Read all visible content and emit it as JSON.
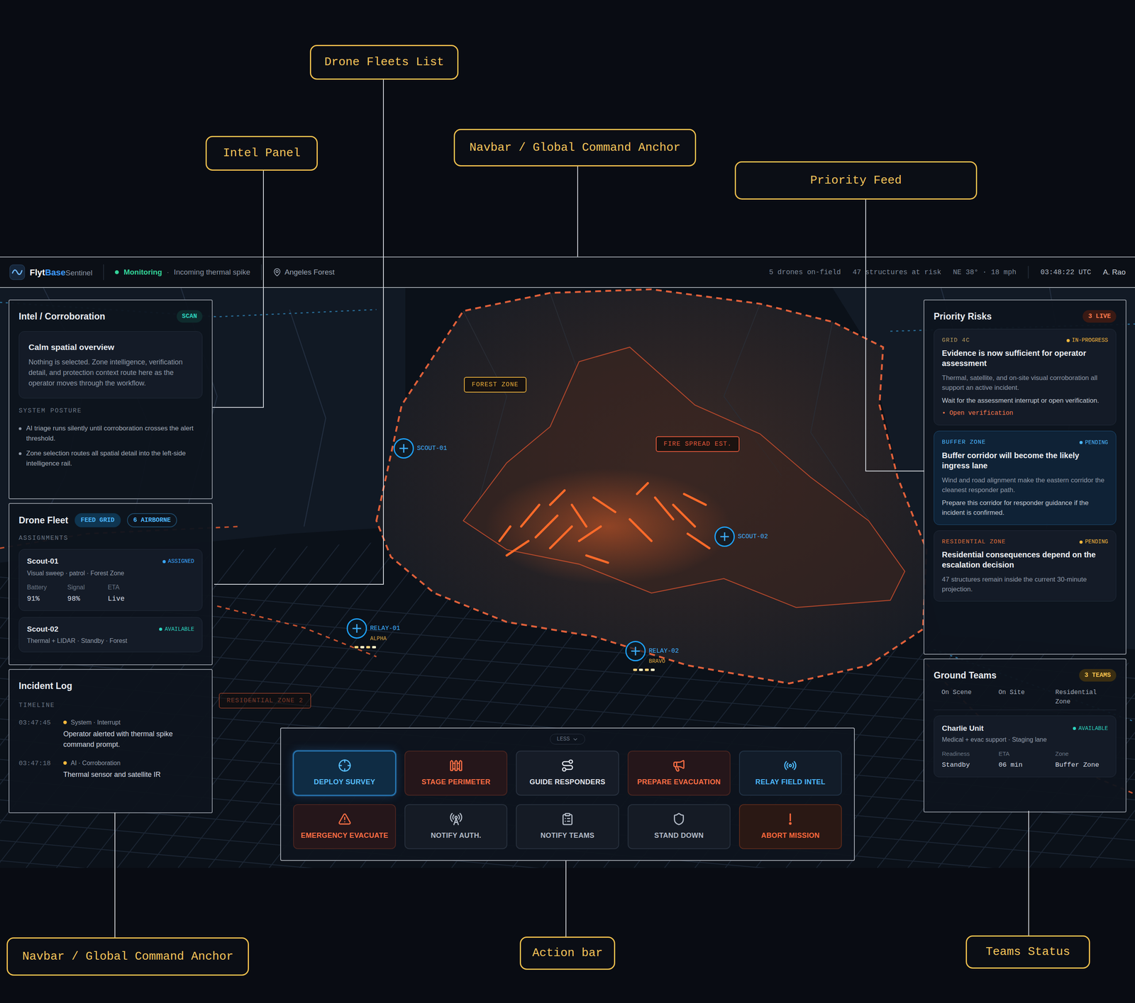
{
  "callouts": [
    {
      "text": "Drone Fleets List"
    },
    {
      "text": "Intel Panel"
    },
    {
      "text": "Navbar / Global Command Anchor"
    },
    {
      "text": "Priority Feed"
    },
    {
      "text": "Navbar / Global Command Anchor"
    },
    {
      "text": "Action bar"
    },
    {
      "text": "Teams Status"
    }
  ],
  "navbar": {
    "brand": {
      "part1": "Flyt",
      "part2": "Base",
      "product": "Sentinel"
    },
    "status": {
      "label": "Monitoring",
      "color": "#34d399"
    },
    "separator": "·",
    "event": "Incoming thermal spike",
    "location": "Angeles Forest",
    "stats": [
      "5 drones on-field",
      "47 structures at risk",
      "NE 38° · 18 mph"
    ],
    "clock": "03:48:22 UTC",
    "user": "A. Rao"
  },
  "intel": {
    "title": "Intel / Corroboration",
    "badge": "SCAN",
    "card": {
      "title": "Calm spatial overview",
      "body": "Nothing is selected. Zone intelligence, verification detail, and protection context route here as the operator moves through the workflow."
    },
    "section": "SYSTEM POSTURE",
    "bullets": [
      "AI triage runs silently until corroboration crosses the alert threshold.",
      "Zone selection routes all spatial detail into the left-side intelligence rail."
    ]
  },
  "fleet": {
    "title": "Drone Fleet",
    "tabs": [
      {
        "label": "FEED GRID",
        "selected": true
      },
      {
        "label": "6 AIRBORNE",
        "selected": false
      }
    ],
    "section": "ASSIGNMENTS",
    "drones": [
      {
        "name": "Scout-01",
        "detail": "Visual sweep · patrol · Forest Zone",
        "status": "ASSIGNED",
        "color": "#3aa7ff",
        "stats": [
          {
            "label": "Battery",
            "value": "91%"
          },
          {
            "label": "Signal",
            "value": "98%"
          },
          {
            "label": "ETA",
            "value": "Live"
          }
        ]
      },
      {
        "name": "Scout-02",
        "detail": "Thermal + LIDAR · Standby · Forest",
        "status": "AVAILABLE",
        "color": "#2dd4bf",
        "stats": []
      }
    ]
  },
  "incident": {
    "title": "Incident Log",
    "section": "TIMELINE",
    "entries": [
      {
        "time": "03:47:45",
        "source": "System · Interrupt",
        "text": "Operator alerted with thermal spike command prompt.",
        "color": "#f5b83d"
      },
      {
        "time": "03:47:18",
        "source": "AI · Corroboration",
        "text": "Thermal sensor and satellite IR",
        "color": "#f5b83d"
      }
    ]
  },
  "risks": {
    "title": "Priority Risks",
    "badge": "3 LIVE",
    "items": [
      {
        "zone": "GRID 4C",
        "color": "#b79a5e",
        "status": "IN-PROGRESS",
        "status_color": "#f5b83d",
        "selected": false,
        "title": "Evidence is now sufficient for operator assessment",
        "body": [
          "Thermal, satellite, and on-site visual corroboration all support an active incident.",
          "Wait for the assessment interrupt or open verification."
        ],
        "link": "• Open verification"
      },
      {
        "zone": "BUFFER ZONE",
        "color": "#4db8ff",
        "status": "PENDING",
        "status_color": "#4db8ff",
        "selected": true,
        "title": "Buffer corridor will become the likely ingress lane",
        "body": [
          "Wind and road alignment make the eastern corridor the cleanest responder path.",
          "Prepare this corridor for responder guidance if the incident is confirmed."
        ],
        "link": ""
      },
      {
        "zone": "RESIDENTIAL ZONE",
        "color": "#e0703a",
        "status": "PENDING",
        "status_color": "#f5b83d",
        "selected": false,
        "title": "Residential consequences depend on the escalation decision",
        "body": [
          "47 structures remain inside the current 30-minute projection."
        ],
        "link": ""
      }
    ]
  },
  "teams": {
    "title": "Ground Teams",
    "badge": "3 TEAMS",
    "partial": [
      "On Scene",
      "On Site",
      "Residential Zone"
    ],
    "items": [
      {
        "name": "Charlie Unit",
        "detail": "Medical + evac support · Staging lane",
        "status": "AVAILABLE",
        "color": "#2dd4bf",
        "fields": [
          {
            "label": "Readiness",
            "value": "Standby"
          },
          {
            "label": "ETA",
            "value": "06 min"
          },
          {
            "label": "Zone",
            "value": "Buffer Zone"
          }
        ]
      }
    ]
  },
  "actions": {
    "toggle": "LESS",
    "buttons": [
      {
        "label": "DEPLOY SURVEY",
        "tone": "primary",
        "selected": true
      },
      {
        "label": "STAGE PERIMETER",
        "tone": "warning",
        "selected": false
      },
      {
        "label": "GUIDE RESPONDERS",
        "tone": "light",
        "selected": false
      },
      {
        "label": "PREPARE EVACUATION",
        "tone": "warning",
        "selected": false
      },
      {
        "label": "RELAY FIELD INTEL",
        "tone": "info",
        "selected": false
      },
      {
        "label": "EMERGENCY EVACUATE",
        "tone": "warning",
        "selected": false
      },
      {
        "label": "NOTIFY AUTH.",
        "tone": "muted",
        "selected": false
      },
      {
        "label": "NOTIFY TEAMS",
        "tone": "muted",
        "selected": false
      },
      {
        "label": "STAND DOWN",
        "tone": "muted",
        "selected": false
      },
      {
        "label": "ABORT MISSION",
        "tone": "danger",
        "selected": false
      }
    ]
  },
  "map": {
    "zones": [
      {
        "label": "FOREST ZONE",
        "color": "#e0a93a"
      },
      {
        "label": "FIRE SPREAD EST.",
        "color": "#e0573a"
      },
      {
        "label": "RESIDENTIAL ZONE 2",
        "color": "#c4512f"
      }
    ],
    "drones": [
      {
        "label": "SCOUT-01",
        "sub": ""
      },
      {
        "label": "SCOUT-02",
        "sub": ""
      },
      {
        "label": "RELAY-01",
        "sub": "ALPHA"
      },
      {
        "label": "RELAY-02",
        "sub": "BRAVO"
      }
    ]
  }
}
